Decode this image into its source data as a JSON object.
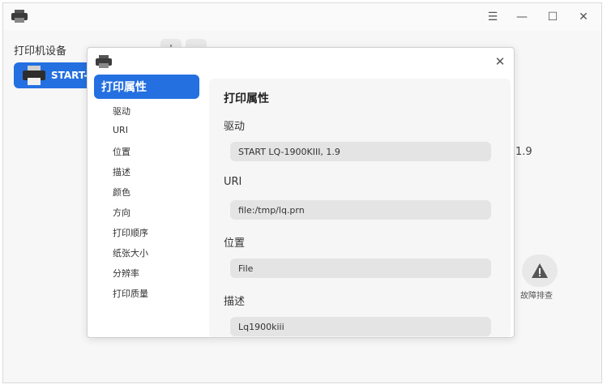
{
  "main": {
    "panel_title": "打印机设备",
    "device_name": "START-L",
    "version_text": "1.9",
    "troubleshoot_label": "故障排查",
    "add_symbol": "+",
    "remove_symbol": "–"
  },
  "window_controls": {
    "menu": "☰",
    "minimize": "—",
    "maximize": "☐",
    "close": "✕"
  },
  "dialog": {
    "close_symbol": "✕",
    "nav": {
      "active": "打印属性",
      "items": [
        "驱动",
        "URI",
        "位置",
        "描述",
        "颜色",
        "方向",
        "打印顺序",
        "纸张大小",
        "分辨率",
        "打印质量"
      ]
    },
    "content": {
      "title": "打印属性",
      "fields": [
        {
          "label": "驱动",
          "value": "START LQ-1900KIII, 1.9"
        },
        {
          "label": "URI",
          "value": "file:/tmp/lq.prn"
        },
        {
          "label": "位置",
          "value": "File"
        },
        {
          "label": "描述",
          "value": "Lq1900kiii"
        }
      ]
    }
  },
  "colors": {
    "accent": "#2470e0",
    "field_bg": "#e4e4e4",
    "content_bg": "#f6f6f6"
  },
  "icons": {
    "app": "printer-icon",
    "device": "printer-icon",
    "troubleshoot": "warning-icon"
  }
}
